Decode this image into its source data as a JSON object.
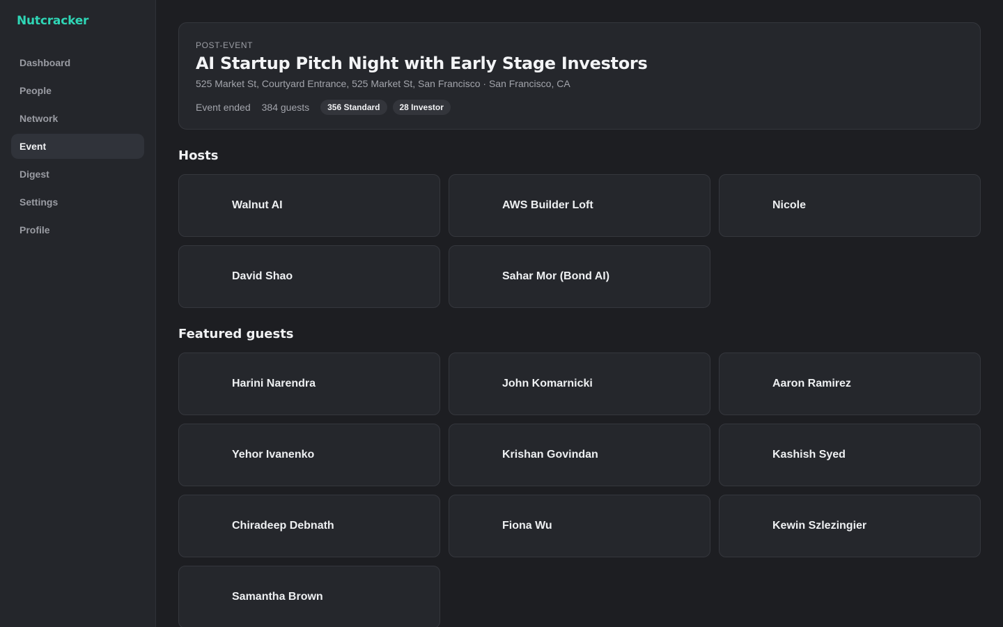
{
  "brand": "Nutcracker",
  "nav": {
    "items": [
      {
        "label": "Dashboard",
        "active": false
      },
      {
        "label": "People",
        "active": false
      },
      {
        "label": "Network",
        "active": false
      },
      {
        "label": "Event",
        "active": true
      },
      {
        "label": "Digest",
        "active": false
      },
      {
        "label": "Settings",
        "active": false
      },
      {
        "label": "Profile",
        "active": false
      }
    ]
  },
  "event": {
    "status": "POST-EVENT",
    "title": "AI Startup Pitch Night with Early Stage Investors",
    "address": "525 Market St, Courtyard Entrance, 525 Market St, San Francisco · San Francisco, CA",
    "state": "Event ended",
    "guest_count": "384 guests",
    "tickets": [
      "356 Standard",
      "28 Investor"
    ]
  },
  "hosts": {
    "title": "Hosts",
    "items": [
      "Walnut AI",
      "AWS Builder Loft",
      "Nicole",
      "David Shao",
      "Sahar Mor (Bond AI)"
    ]
  },
  "guests": {
    "title": "Featured guests",
    "items": [
      "Harini Narendra",
      "John Komarnicki",
      "Aaron Ramirez",
      "Yehor Ivanenko",
      "Krishan Govindan",
      "Kashish Syed",
      "Chiradeep Debnath",
      "Fiona Wu",
      "Kewin Szlezingier",
      "Samantha Brown"
    ]
  },
  "colors": {
    "accent": "#2fd6b6",
    "background": "#1d1e22",
    "sidebar": "#24262b",
    "card": "#25272c"
  }
}
